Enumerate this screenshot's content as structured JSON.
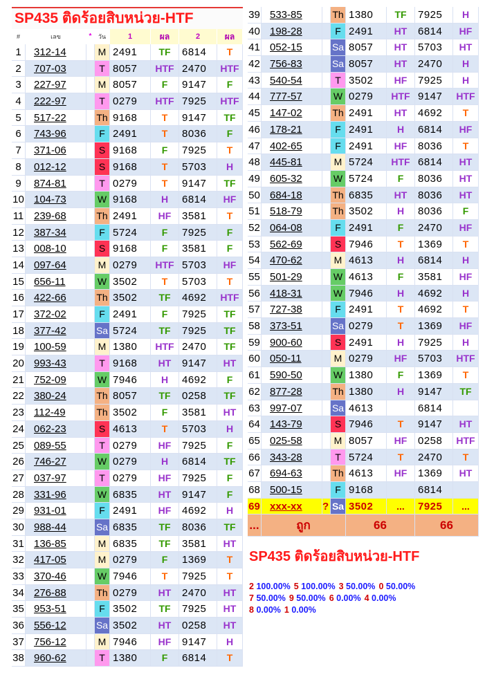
{
  "title": "SP435 ติดร้อยสิบหน่วย-HTF",
  "header": {
    "col_no": "#",
    "col_num": "เลข",
    "col_star": "*",
    "col_day": "วัน",
    "col_one": "1",
    "col_res1": "ผล",
    "col_two": "2",
    "col_res2": "ผล"
  },
  "rows": [
    {
      "no": "1",
      "num": "312-14",
      "day": "M",
      "n1": "2491",
      "r1": "TF",
      "n2": "6814",
      "r2": "T"
    },
    {
      "no": "2",
      "num": "707-03",
      "day": "T",
      "n1": "8057",
      "r1": "HTF",
      "n2": "2470",
      "r2": "HTF"
    },
    {
      "no": "3",
      "num": "227-97",
      "day": "M",
      "n1": "8057",
      "r1": "F",
      "n2": "9147",
      "r2": "F"
    },
    {
      "no": "4",
      "num": "222-97",
      "day": "T",
      "n1": "0279",
      "r1": "HTF",
      "n2": "7925",
      "r2": "HTF"
    },
    {
      "no": "5",
      "num": "517-22",
      "day": "Th",
      "n1": "9168",
      "r1": "T",
      "n2": "9147",
      "r2": "TF"
    },
    {
      "no": "6",
      "num": "743-96",
      "day": "F",
      "n1": "2491",
      "r1": "T",
      "n2": "8036",
      "r2": "F"
    },
    {
      "no": "7",
      "num": "371-06",
      "day": "S",
      "n1": "9168",
      "r1": "F",
      "n2": "7925",
      "r2": "T"
    },
    {
      "no": "8",
      "num": "012-12",
      "day": "S",
      "n1": "9168",
      "r1": "T",
      "n2": "5703",
      "r2": "H"
    },
    {
      "no": "9",
      "num": "874-81",
      "day": "T",
      "n1": "0279",
      "r1": "T",
      "n2": "9147",
      "r2": "TF"
    },
    {
      "no": "10",
      "num": "104-73",
      "day": "W",
      "n1": "9168",
      "r1": "H",
      "n2": "6814",
      "r2": "HF"
    },
    {
      "no": "11",
      "num": "239-68",
      "day": "Th",
      "n1": "2491",
      "r1": "HF",
      "n2": "3581",
      "r2": "T"
    },
    {
      "no": "12",
      "num": "387-34",
      "day": "F",
      "n1": "5724",
      "r1": "F",
      "n2": "7925",
      "r2": "F"
    },
    {
      "no": "13",
      "num": "008-10",
      "day": "S",
      "n1": "9168",
      "r1": "F",
      "n2": "3581",
      "r2": "F"
    },
    {
      "no": "14",
      "num": "097-64",
      "day": "M",
      "n1": "0279",
      "r1": "HTF",
      "n2": "5703",
      "r2": "HF"
    },
    {
      "no": "15",
      "num": "656-11",
      "day": "W",
      "n1": "3502",
      "r1": "T",
      "n2": "5703",
      "r2": "T"
    },
    {
      "no": "16",
      "num": "422-66",
      "day": "Th",
      "n1": "3502",
      "r1": "TF",
      "n2": "4692",
      "r2": "HTF"
    },
    {
      "no": "17",
      "num": "372-02",
      "day": "F",
      "n1": "2491",
      "r1": "F",
      "n2": "7925",
      "r2": "TF"
    },
    {
      "no": "18",
      "num": "377-42",
      "day": "Sa",
      "n1": "5724",
      "r1": "TF",
      "n2": "7925",
      "r2": "TF"
    },
    {
      "no": "19",
      "num": "100-59",
      "day": "M",
      "n1": "1380",
      "r1": "HTF",
      "n2": "2470",
      "r2": "TF"
    },
    {
      "no": "20",
      "num": "993-43",
      "day": "T",
      "n1": "9168",
      "r1": "HT",
      "n2": "9147",
      "r2": "HT"
    },
    {
      "no": "21",
      "num": "752-09",
      "day": "W",
      "n1": "7946",
      "r1": "H",
      "n2": "4692",
      "r2": "F"
    },
    {
      "no": "22",
      "num": "380-24",
      "day": "Th",
      "n1": "8057",
      "r1": "TF",
      "n2": "0258",
      "r2": "TF"
    },
    {
      "no": "23",
      "num": "112-49",
      "day": "Th",
      "n1": "3502",
      "r1": "F",
      "n2": "3581",
      "r2": "HT"
    },
    {
      "no": "24",
      "num": "062-23",
      "day": "S",
      "n1": "4613",
      "r1": "T",
      "n2": "5703",
      "r2": "H"
    },
    {
      "no": "25",
      "num": "089-55",
      "day": "T",
      "n1": "0279",
      "r1": "HF",
      "n2": "7925",
      "r2": "F"
    },
    {
      "no": "26",
      "num": "746-27",
      "day": "W",
      "n1": "0279",
      "r1": "H",
      "n2": "6814",
      "r2": "TF"
    },
    {
      "no": "27",
      "num": "037-97",
      "day": "T",
      "n1": "0279",
      "r1": "HF",
      "n2": "7925",
      "r2": "F"
    },
    {
      "no": "28",
      "num": "331-96",
      "day": "W",
      "n1": "6835",
      "r1": "HT",
      "n2": "9147",
      "r2": "F"
    },
    {
      "no": "29",
      "num": "931-01",
      "day": "F",
      "n1": "2491",
      "r1": "HF",
      "n2": "4692",
      "r2": "H"
    },
    {
      "no": "30",
      "num": "988-44",
      "day": "Sa",
      "n1": "6835",
      "r1": "TF",
      "n2": "8036",
      "r2": "TF"
    },
    {
      "no": "31",
      "num": "136-85",
      "day": "M",
      "n1": "6835",
      "r1": "TF",
      "n2": "3581",
      "r2": "HT"
    },
    {
      "no": "32",
      "num": "417-05",
      "day": "M",
      "n1": "0279",
      "r1": "F",
      "n2": "1369",
      "r2": "T"
    },
    {
      "no": "33",
      "num": "370-46",
      "day": "W",
      "n1": "7946",
      "r1": "T",
      "n2": "7925",
      "r2": "T"
    },
    {
      "no": "34",
      "num": "276-88",
      "day": "Th",
      "n1": "0279",
      "r1": "HT",
      "n2": "2470",
      "r2": "HT"
    },
    {
      "no": "35",
      "num": "953-51",
      "day": "F",
      "n1": "3502",
      "r1": "TF",
      "n2": "7925",
      "r2": "HT"
    },
    {
      "no": "36",
      "num": "556-12",
      "day": "Sa",
      "n1": "3502",
      "r1": "HT",
      "n2": "0258",
      "r2": "HT"
    },
    {
      "no": "37",
      "num": "756-12",
      "day": "M",
      "n1": "7946",
      "r1": "HF",
      "n2": "9147",
      "r2": "H"
    },
    {
      "no": "38",
      "num": "960-62",
      "day": "T",
      "n1": "1380",
      "r1": "F",
      "n2": "6814",
      "r2": "T"
    },
    {
      "no": "39",
      "num": "533-85",
      "day": "Th",
      "n1": "1380",
      "r1": "TF",
      "n2": "7925",
      "r2": "H"
    },
    {
      "no": "40",
      "num": "198-28",
      "day": "F",
      "n1": "2491",
      "r1": "HT",
      "n2": "6814",
      "r2": "HF"
    },
    {
      "no": "41",
      "num": "052-15",
      "day": "Sa",
      "n1": "8057",
      "r1": "HT",
      "n2": "5703",
      "r2": "HT"
    },
    {
      "no": "42",
      "num": "756-83",
      "day": "Sa",
      "n1": "8057",
      "r1": "HT",
      "n2": "2470",
      "r2": "H"
    },
    {
      "no": "43",
      "num": "540-54",
      "day": "T",
      "n1": "3502",
      "r1": "HF",
      "n2": "7925",
      "r2": "H"
    },
    {
      "no": "44",
      "num": "777-57",
      "day": "W",
      "n1": "0279",
      "r1": "HTF",
      "n2": "9147",
      "r2": "HTF"
    },
    {
      "no": "45",
      "num": "147-02",
      "day": "Th",
      "n1": "2491",
      "r1": "HT",
      "n2": "4692",
      "r2": "T"
    },
    {
      "no": "46",
      "num": "178-21",
      "day": "F",
      "n1": "2491",
      "r1": "H",
      "n2": "6814",
      "r2": "HF"
    },
    {
      "no": "47",
      "num": "402-65",
      "day": "F",
      "n1": "2491",
      "r1": "HF",
      "n2": "8036",
      "r2": "T"
    },
    {
      "no": "48",
      "num": "445-81",
      "day": "M",
      "n1": "5724",
      "r1": "HTF",
      "n2": "6814",
      "r2": "HT"
    },
    {
      "no": "49",
      "num": "605-32",
      "day": "W",
      "n1": "5724",
      "r1": "F",
      "n2": "8036",
      "r2": "HT"
    },
    {
      "no": "50",
      "num": "684-18",
      "day": "Th",
      "n1": "6835",
      "r1": "HT",
      "n2": "8036",
      "r2": "HT"
    },
    {
      "no": "51",
      "num": "518-79",
      "day": "Th",
      "n1": "3502",
      "r1": "H",
      "n2": "8036",
      "r2": "F"
    },
    {
      "no": "52",
      "num": "064-08",
      "day": "F",
      "n1": "2491",
      "r1": "F",
      "n2": "2470",
      "r2": "HF"
    },
    {
      "no": "53",
      "num": "562-69",
      "day": "S",
      "n1": "7946",
      "r1": "T",
      "n2": "1369",
      "r2": "T"
    },
    {
      "no": "54",
      "num": "470-62",
      "day": "M",
      "n1": "4613",
      "r1": "H",
      "n2": "6814",
      "r2": "H"
    },
    {
      "no": "55",
      "num": "501-29",
      "day": "W",
      "n1": "4613",
      "r1": "F",
      "n2": "3581",
      "r2": "HF"
    },
    {
      "no": "56",
      "num": "418-31",
      "day": "W",
      "n1": "7946",
      "r1": "H",
      "n2": "4692",
      "r2": "H"
    },
    {
      "no": "57",
      "num": "727-38",
      "day": "F",
      "n1": "2491",
      "r1": "T",
      "n2": "4692",
      "r2": "T"
    },
    {
      "no": "58",
      "num": "373-51",
      "day": "Sa",
      "n1": "0279",
      "r1": "T",
      "n2": "1369",
      "r2": "HF"
    },
    {
      "no": "59",
      "num": "900-60",
      "day": "S",
      "n1": "2491",
      "r1": "H",
      "n2": "7925",
      "r2": "H"
    },
    {
      "no": "60",
      "num": "050-11",
      "day": "M",
      "n1": "0279",
      "r1": "HF",
      "n2": "5703",
      "r2": "HTF"
    },
    {
      "no": "61",
      "num": "590-50",
      "day": "W",
      "n1": "1380",
      "r1": "F",
      "n2": "1369",
      "r2": "T"
    },
    {
      "no": "62",
      "num": "877-28",
      "day": "Th",
      "n1": "1380",
      "r1": "H",
      "n2": "9147",
      "r2": "TF"
    },
    {
      "no": "63",
      "num": "997-07",
      "day": "Sa",
      "n1": "4613",
      "r1": "",
      "n2": "6814",
      "r2": ""
    },
    {
      "no": "64",
      "num": "143-79",
      "day": "S",
      "n1": "7946",
      "r1": "T",
      "n2": "9147",
      "r2": "HT"
    },
    {
      "no": "65",
      "num": "025-58",
      "day": "M",
      "n1": "8057",
      "r1": "HF",
      "n2": "0258",
      "r2": "HTF"
    },
    {
      "no": "66",
      "num": "343-28",
      "day": "T",
      "n1": "5724",
      "r1": "T",
      "n2": "2470",
      "r2": "T"
    },
    {
      "no": "67",
      "num": "694-63",
      "day": "Th",
      "n1": "4613",
      "r1": "HF",
      "n2": "1369",
      "r2": "HT"
    },
    {
      "no": "68",
      "num": "500-15",
      "day": "F",
      "n1": "9168",
      "r1": "",
      "n2": "6814",
      "r2": ""
    }
  ],
  "highlight_row": {
    "no": "69",
    "num": "xxx-xx",
    "q": "?",
    "day": "Sa",
    "n1": "3502",
    "r1": "...",
    "n2": "7925",
    "r2": "..."
  },
  "total_row": {
    "no": "...",
    "label": "ถูก",
    "hits1": "66",
    "hits2": "66"
  },
  "stats": [
    {
      "digit": "2",
      "pct": "100.00%"
    },
    {
      "digit": "5",
      "pct": "100.00%"
    },
    {
      "digit": "3",
      "pct": "50.00%"
    },
    {
      "digit": "0",
      "pct": "50.00%"
    },
    {
      "digit": "7",
      "pct": "50.00%"
    },
    {
      "digit": "9",
      "pct": "50.00%"
    },
    {
      "digit": "6",
      "pct": "0.00%"
    },
    {
      "digit": "4",
      "pct": "0.00%"
    },
    {
      "digit": "8",
      "pct": "0.00%"
    },
    {
      "digit": "1",
      "pct": "0.00%"
    }
  ]
}
